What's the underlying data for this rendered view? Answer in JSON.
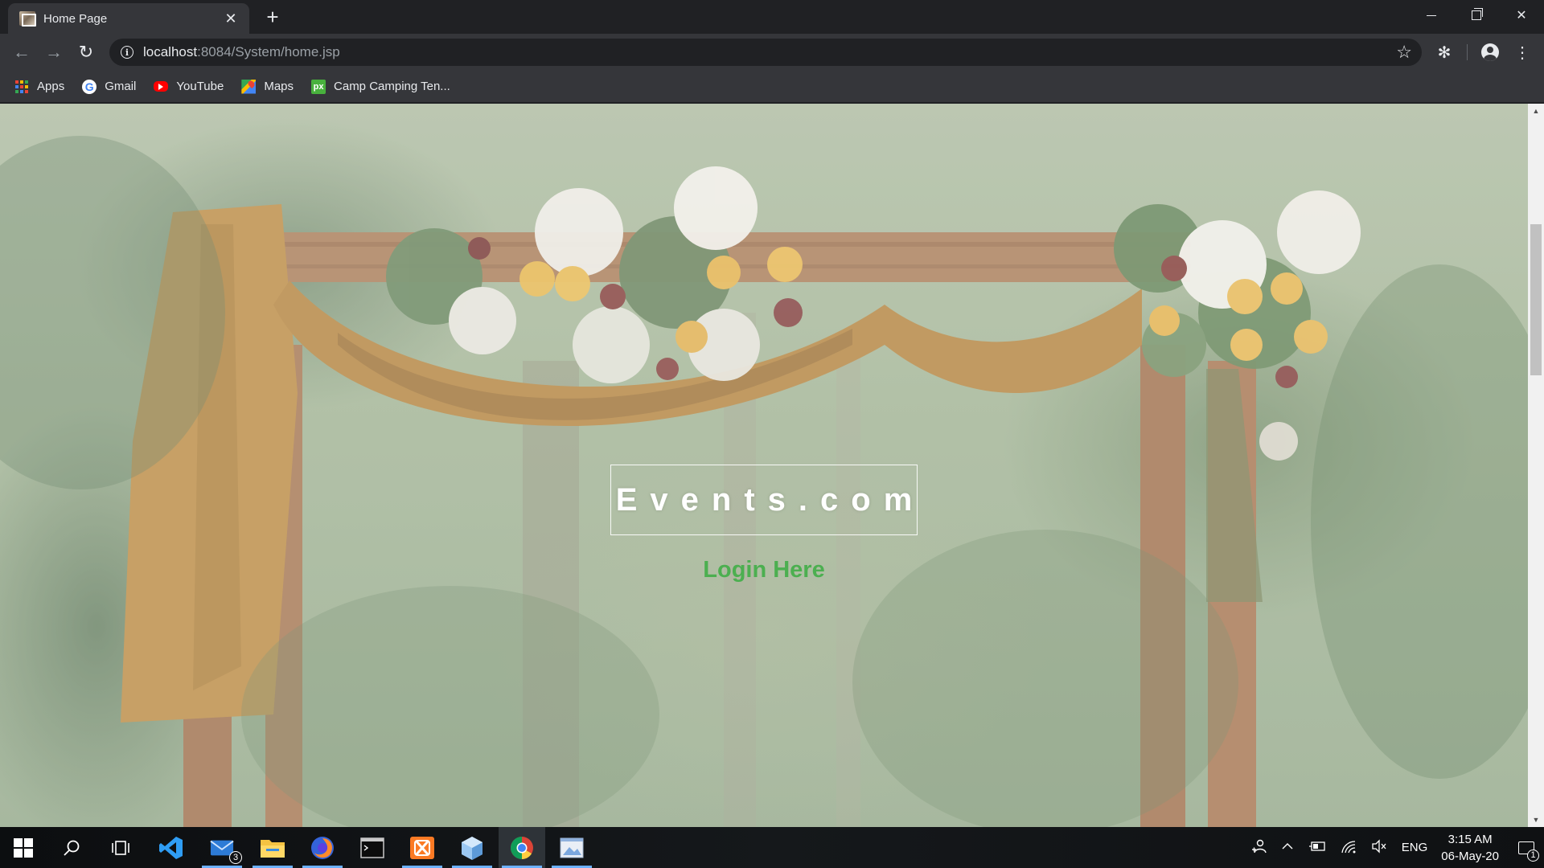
{
  "browser": {
    "tab": {
      "title": "Home Page",
      "close": "✕",
      "new_tab": "+"
    },
    "window_controls": {
      "minimize": "minimize",
      "restore": "restore",
      "close": "✕"
    },
    "toolbar": {
      "back": "←",
      "forward": "→",
      "reload": "↻",
      "url_host": "localhost",
      "url_rest": ":8084/System/home.jsp",
      "bookmark_star": "☆",
      "extension": "✻",
      "menu": "⋮"
    },
    "bookmarks": [
      {
        "label": "Apps",
        "icon": "apps-grid-icon"
      },
      {
        "label": "Gmail",
        "icon": "google-icon"
      },
      {
        "label": "YouTube",
        "icon": "youtube-icon"
      },
      {
        "label": "Maps",
        "icon": "maps-icon"
      },
      {
        "label": "Camp Camping Ten...",
        "icon": "px-icon"
      }
    ]
  },
  "page": {
    "brand": "Events.com",
    "login_link": "Login Here",
    "login_color": "#4caf50",
    "background_image": "wooden wedding arch with draped mustard fabric and white, yellow and burgundy flowers in a forest"
  },
  "taskbar": {
    "apps": [
      {
        "name": "start",
        "icon": "windows-logo-icon"
      },
      {
        "name": "search",
        "icon": "search-icon"
      },
      {
        "name": "task-view",
        "icon": "task-view-icon"
      },
      {
        "name": "vscode",
        "icon": "vscode-icon"
      },
      {
        "name": "mail",
        "icon": "mail-icon",
        "badge": "3"
      },
      {
        "name": "file-explorer",
        "icon": "folder-icon"
      },
      {
        "name": "firefox",
        "icon": "firefox-icon"
      },
      {
        "name": "terminal",
        "icon": "terminal-icon"
      },
      {
        "name": "xampp",
        "icon": "xampp-icon"
      },
      {
        "name": "box",
        "icon": "box-icon"
      },
      {
        "name": "chrome",
        "icon": "chrome-icon"
      },
      {
        "name": "photos",
        "icon": "photos-icon"
      }
    ],
    "tray": {
      "language": "ENG",
      "time": "3:15 AM",
      "date": "06-May-20",
      "notifications": "1"
    }
  }
}
